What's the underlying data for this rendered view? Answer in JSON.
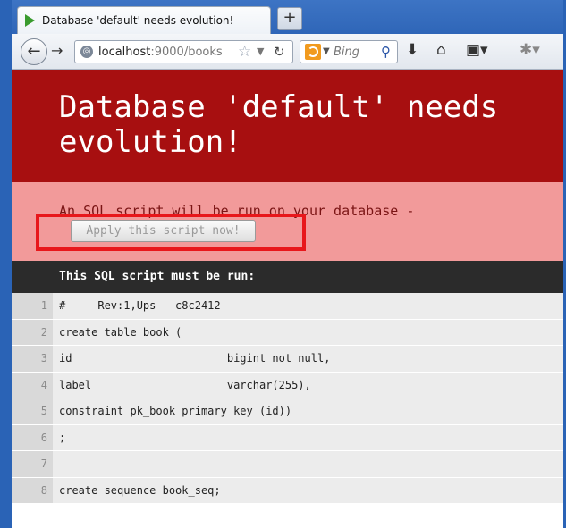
{
  "browser": {
    "tab_title": "Database 'default' needs evolution!",
    "tab_close": "×",
    "new_tab": "+",
    "url_host": "localhost",
    "url_rest": ":9000/books",
    "search_engine": "Bing",
    "icons": {
      "back": "back-arrow-icon",
      "forward": "forward-arrow-icon",
      "site": "globe-icon",
      "bookmark": "star-icon",
      "reload": "reload-icon",
      "search": "magnifier-icon",
      "download": "download-icon",
      "home": "home-icon",
      "bookmarks_menu": "bookmarks-menu-icon",
      "addon": "addon-icon"
    }
  },
  "page": {
    "title": "Database 'default' needs evolution!",
    "notice": "An SQL script will be run on your database -",
    "apply_button": "Apply this script now!",
    "script_header": "This SQL script must be run:",
    "lines": [
      {
        "no": "1",
        "text": "# --- Rev:1,Ups - c8c2412"
      },
      {
        "no": "2",
        "text": "create table book ("
      },
      {
        "no": "3",
        "text": "id                        bigint not null,"
      },
      {
        "no": "4",
        "text": "label                     varchar(255),"
      },
      {
        "no": "5",
        "text": "constraint pk_book primary key (id))"
      },
      {
        "no": "6",
        "text": ";"
      },
      {
        "no": "7",
        "text": ""
      },
      {
        "no": "8",
        "text": "create sequence book_seq;"
      }
    ]
  },
  "colors": {
    "header_bg": "#a70f10",
    "notice_bg": "#f29a9a",
    "script_header_bg": "#2b2b2b",
    "highlight_border": "#e8171b"
  }
}
